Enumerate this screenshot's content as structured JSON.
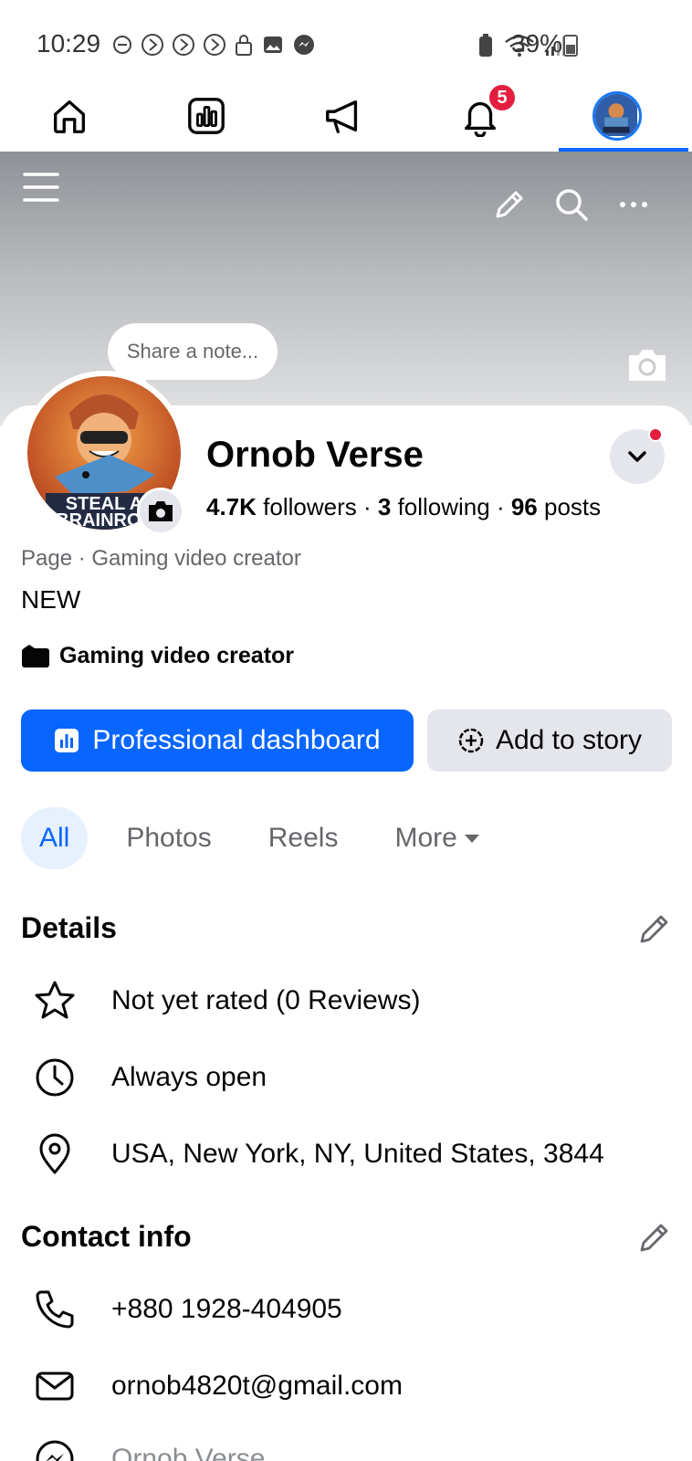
{
  "status_bar": {
    "time": "10:29",
    "battery": "39%"
  },
  "nav": {
    "notifications_badge": "5",
    "active_tab": "profile"
  },
  "cover": {
    "note_placeholder": "Share a note..."
  },
  "profile": {
    "name": "Ornob Verse",
    "followers_count": "4.7K",
    "followers_label": "followers",
    "following_count": "3",
    "following_label": "following",
    "posts_count": "96",
    "posts_label": "posts",
    "separator": " · ",
    "category": "Page · Gaming video creator",
    "bio": "NEW",
    "creator_label": "Gaming video creator"
  },
  "actions": {
    "primary": "Professional dashboard",
    "secondary": "Add to story"
  },
  "tabs": [
    {
      "label": "All",
      "active": true
    },
    {
      "label": "Photos",
      "active": false
    },
    {
      "label": "Reels",
      "active": false
    },
    {
      "label": "More",
      "active": false
    }
  ],
  "details": {
    "title": "Details",
    "items": [
      {
        "icon": "star-icon",
        "text": "Not yet rated (0 Reviews)"
      },
      {
        "icon": "clock-icon",
        "text": "Always open"
      },
      {
        "icon": "location-pin-icon",
        "text": "USA, New York, NY, United States, 3844"
      }
    ]
  },
  "contact": {
    "title": "Contact info",
    "items": [
      {
        "icon": "phone-icon",
        "text": "+880 1928-404905"
      },
      {
        "icon": "mail-icon",
        "text": "ornob4820t@gmail.com"
      },
      {
        "icon": "messenger-icon",
        "text": "Ornob Verse"
      }
    ]
  },
  "colors": {
    "accent": "#0866ff",
    "badge": "#e41e3f",
    "secondary_button": "#e4e6eb",
    "muted_text": "#65676b"
  }
}
